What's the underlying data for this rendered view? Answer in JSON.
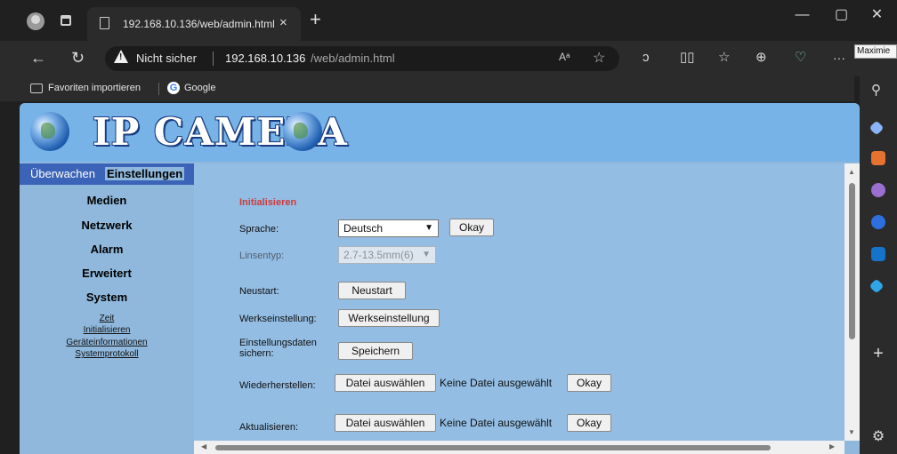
{
  "browser": {
    "tab_title": "192.168.10.136/web/admin.html",
    "tab_close": "×",
    "new_tab": "+",
    "insecure_label": "Nicht sicher",
    "url_host": "192.168.10.136",
    "url_path": "/web/admin.html",
    "read_aloud": "Aᵃ",
    "more": "···",
    "profile_tooltip": "Maximie",
    "window": {
      "minimize": "—",
      "maximize": "▢",
      "close": "✕"
    }
  },
  "favorites": [
    {
      "label": "Favoriten importieren"
    },
    {
      "label": "Google"
    }
  ],
  "page": {
    "logo_text": "IP CAMERA",
    "nav_tabs": [
      "Überwachen",
      "Einstellungen"
    ],
    "nav_categories": [
      "Medien",
      "Netzwerk",
      "Alarm",
      "Erweitert",
      "System"
    ],
    "nav_sublinks": [
      "Zeit",
      "Initialisieren",
      "Geräteinformationen",
      "Systemprotokoll"
    ],
    "section_title": "Initialisieren",
    "rows": {
      "language": {
        "label": "Sprache:",
        "value": "Deutsch",
        "button": "Okay"
      },
      "lens": {
        "label": "Linsentyp:",
        "value": "2.7-13.5mm(6)"
      },
      "restart": {
        "label": "Neustart:",
        "button": "Neustart"
      },
      "factory": {
        "label": "Werkseinstellung:",
        "button": "Werkseinstellung"
      },
      "backup": {
        "label_line1": "Einstellungsdaten",
        "label_line2": "sichern:",
        "button": "Speichern"
      },
      "restore": {
        "label": "Wiederherstellen:",
        "choose": "Datei auswählen",
        "nofile": "Keine Datei ausgewählt",
        "button": "Okay"
      },
      "update": {
        "label": "Aktualisieren:",
        "choose": "Datei auswählen",
        "nofile": "Keine Datei ausgewählt",
        "button": "Okay"
      }
    }
  },
  "colors": {
    "page_bg": "#8fb8dc",
    "header_bg": "#77b3e6",
    "nav_tab_bg": "#3b63b7",
    "section_title": "#ce3a3a"
  },
  "icons": [
    "profile-icon",
    "tabs-icon",
    "page-icon",
    "back-icon",
    "refresh-icon",
    "warning-icon",
    "read-aloud-icon",
    "favorite-star-icon",
    "copilot-icon",
    "split-screen-icon",
    "favorites-icon",
    "collections-icon",
    "heart-pulse-icon",
    "search-icon",
    "tag-icon",
    "briefcase-icon",
    "games-icon",
    "copilot-sidebar-icon",
    "outlook-icon",
    "telegram-icon",
    "add-icon",
    "settings-icon"
  ]
}
